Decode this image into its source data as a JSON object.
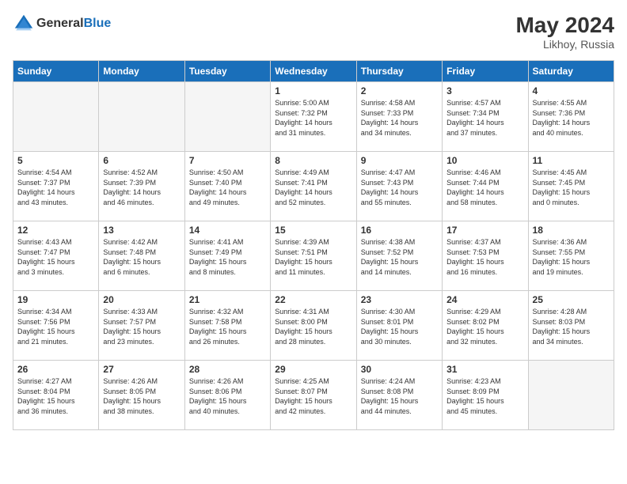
{
  "header": {
    "logo_line1": "General",
    "logo_line2": "Blue",
    "month_year": "May 2024",
    "location": "Likhoy, Russia"
  },
  "days_of_week": [
    "Sunday",
    "Monday",
    "Tuesday",
    "Wednesday",
    "Thursday",
    "Friday",
    "Saturday"
  ],
  "weeks": [
    [
      {
        "day": "",
        "info": ""
      },
      {
        "day": "",
        "info": ""
      },
      {
        "day": "",
        "info": ""
      },
      {
        "day": "1",
        "info": "Sunrise: 5:00 AM\nSunset: 7:32 PM\nDaylight: 14 hours\nand 31 minutes."
      },
      {
        "day": "2",
        "info": "Sunrise: 4:58 AM\nSunset: 7:33 PM\nDaylight: 14 hours\nand 34 minutes."
      },
      {
        "day": "3",
        "info": "Sunrise: 4:57 AM\nSunset: 7:34 PM\nDaylight: 14 hours\nand 37 minutes."
      },
      {
        "day": "4",
        "info": "Sunrise: 4:55 AM\nSunset: 7:36 PM\nDaylight: 14 hours\nand 40 minutes."
      }
    ],
    [
      {
        "day": "5",
        "info": "Sunrise: 4:54 AM\nSunset: 7:37 PM\nDaylight: 14 hours\nand 43 minutes."
      },
      {
        "day": "6",
        "info": "Sunrise: 4:52 AM\nSunset: 7:39 PM\nDaylight: 14 hours\nand 46 minutes."
      },
      {
        "day": "7",
        "info": "Sunrise: 4:50 AM\nSunset: 7:40 PM\nDaylight: 14 hours\nand 49 minutes."
      },
      {
        "day": "8",
        "info": "Sunrise: 4:49 AM\nSunset: 7:41 PM\nDaylight: 14 hours\nand 52 minutes."
      },
      {
        "day": "9",
        "info": "Sunrise: 4:47 AM\nSunset: 7:43 PM\nDaylight: 14 hours\nand 55 minutes."
      },
      {
        "day": "10",
        "info": "Sunrise: 4:46 AM\nSunset: 7:44 PM\nDaylight: 14 hours\nand 58 minutes."
      },
      {
        "day": "11",
        "info": "Sunrise: 4:45 AM\nSunset: 7:45 PM\nDaylight: 15 hours\nand 0 minutes."
      }
    ],
    [
      {
        "day": "12",
        "info": "Sunrise: 4:43 AM\nSunset: 7:47 PM\nDaylight: 15 hours\nand 3 minutes."
      },
      {
        "day": "13",
        "info": "Sunrise: 4:42 AM\nSunset: 7:48 PM\nDaylight: 15 hours\nand 6 minutes."
      },
      {
        "day": "14",
        "info": "Sunrise: 4:41 AM\nSunset: 7:49 PM\nDaylight: 15 hours\nand 8 minutes."
      },
      {
        "day": "15",
        "info": "Sunrise: 4:39 AM\nSunset: 7:51 PM\nDaylight: 15 hours\nand 11 minutes."
      },
      {
        "day": "16",
        "info": "Sunrise: 4:38 AM\nSunset: 7:52 PM\nDaylight: 15 hours\nand 14 minutes."
      },
      {
        "day": "17",
        "info": "Sunrise: 4:37 AM\nSunset: 7:53 PM\nDaylight: 15 hours\nand 16 minutes."
      },
      {
        "day": "18",
        "info": "Sunrise: 4:36 AM\nSunset: 7:55 PM\nDaylight: 15 hours\nand 19 minutes."
      }
    ],
    [
      {
        "day": "19",
        "info": "Sunrise: 4:34 AM\nSunset: 7:56 PM\nDaylight: 15 hours\nand 21 minutes."
      },
      {
        "day": "20",
        "info": "Sunrise: 4:33 AM\nSunset: 7:57 PM\nDaylight: 15 hours\nand 23 minutes."
      },
      {
        "day": "21",
        "info": "Sunrise: 4:32 AM\nSunset: 7:58 PM\nDaylight: 15 hours\nand 26 minutes."
      },
      {
        "day": "22",
        "info": "Sunrise: 4:31 AM\nSunset: 8:00 PM\nDaylight: 15 hours\nand 28 minutes."
      },
      {
        "day": "23",
        "info": "Sunrise: 4:30 AM\nSunset: 8:01 PM\nDaylight: 15 hours\nand 30 minutes."
      },
      {
        "day": "24",
        "info": "Sunrise: 4:29 AM\nSunset: 8:02 PM\nDaylight: 15 hours\nand 32 minutes."
      },
      {
        "day": "25",
        "info": "Sunrise: 4:28 AM\nSunset: 8:03 PM\nDaylight: 15 hours\nand 34 minutes."
      }
    ],
    [
      {
        "day": "26",
        "info": "Sunrise: 4:27 AM\nSunset: 8:04 PM\nDaylight: 15 hours\nand 36 minutes."
      },
      {
        "day": "27",
        "info": "Sunrise: 4:26 AM\nSunset: 8:05 PM\nDaylight: 15 hours\nand 38 minutes."
      },
      {
        "day": "28",
        "info": "Sunrise: 4:26 AM\nSunset: 8:06 PM\nDaylight: 15 hours\nand 40 minutes."
      },
      {
        "day": "29",
        "info": "Sunrise: 4:25 AM\nSunset: 8:07 PM\nDaylight: 15 hours\nand 42 minutes."
      },
      {
        "day": "30",
        "info": "Sunrise: 4:24 AM\nSunset: 8:08 PM\nDaylight: 15 hours\nand 44 minutes."
      },
      {
        "day": "31",
        "info": "Sunrise: 4:23 AM\nSunset: 8:09 PM\nDaylight: 15 hours\nand 45 minutes."
      },
      {
        "day": "",
        "info": ""
      }
    ]
  ]
}
